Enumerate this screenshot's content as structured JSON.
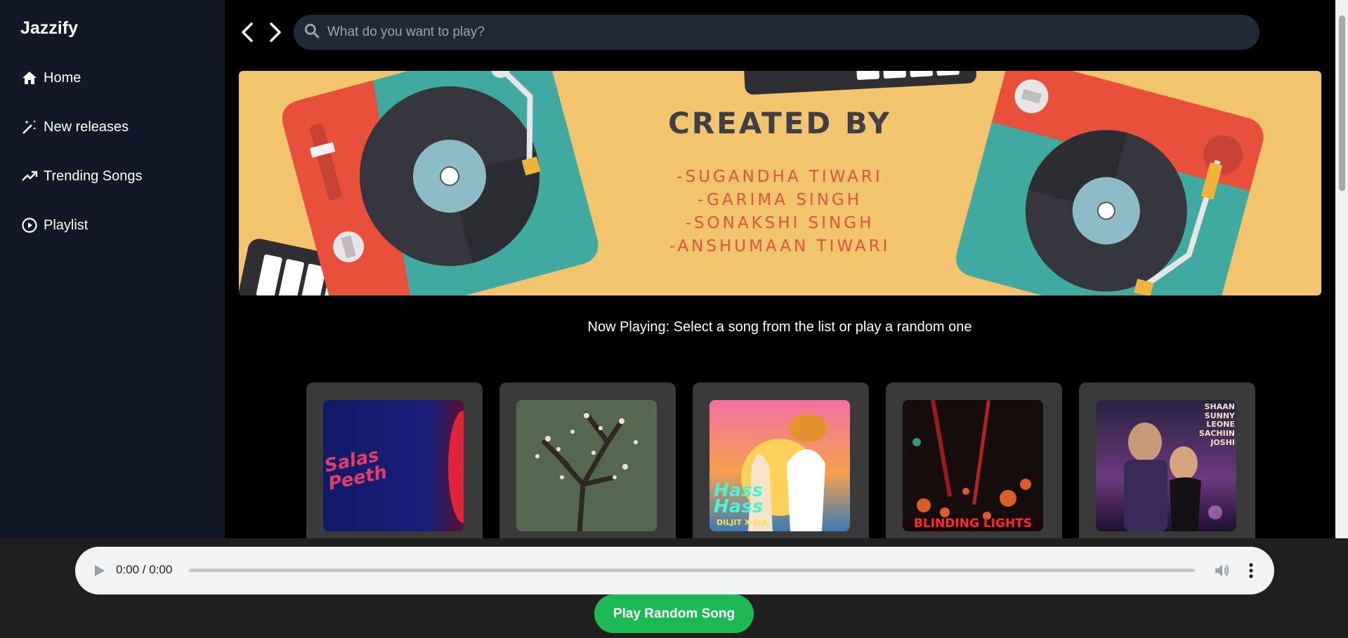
{
  "sidebar": {
    "brand": "Jazzify",
    "items": [
      {
        "label": "Home",
        "icon": "home-icon"
      },
      {
        "label": "New releases",
        "icon": "magic-wand-icon"
      },
      {
        "label": "Trending Songs",
        "icon": "trending-up-icon"
      },
      {
        "label": "Playlist",
        "icon": "play-circle-icon"
      }
    ]
  },
  "header": {
    "back_icon": "chevron-left-icon",
    "forward_icon": "chevron-right-icon",
    "search_placeholder": "What do you want to play?"
  },
  "banner": {
    "title": "CREATED BY",
    "names": [
      "-SUGANDHA TIWARI",
      "-GARIMA SINGH",
      "-SONAKSHI SINGH",
      "-ANSHUMAAN TIWARI"
    ],
    "colors": {
      "background": "#f2c46d",
      "names": "#e2533e",
      "title": "#3f3f48"
    }
  },
  "now_playing": "Now Playing: Select a song from the list or play a random one",
  "songs": [
    {
      "cover_text": "Salas Peeth",
      "theme": "navy-red"
    },
    {
      "cover_text": "",
      "theme": "blossom-tree"
    },
    {
      "cover_text": "Hass Hass",
      "sub_text": "DILJIT X SIA",
      "theme": "sunset-pop"
    },
    {
      "cover_text": "BLINDING LIGHTS",
      "theme": "dark-bokeh"
    },
    {
      "cover_text": "SHAAN  SUNNY LEONE  SACHIIN JOSHI",
      "theme": "purple-glam"
    }
  ],
  "player": {
    "time": "0:00 / 0:00",
    "random_button": "Play Random Song",
    "accent": "#1db954"
  }
}
